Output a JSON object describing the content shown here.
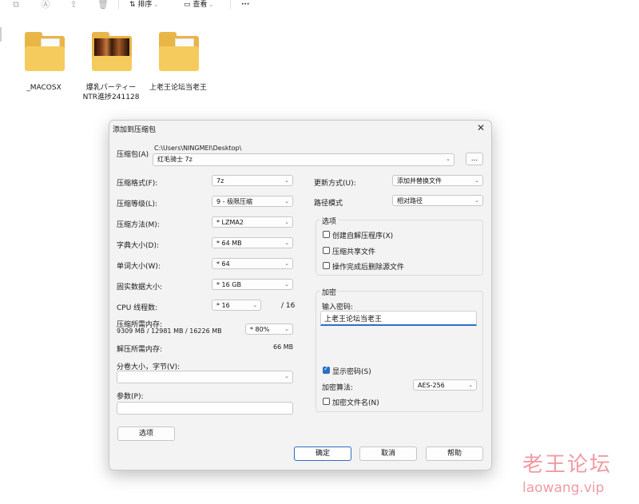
{
  "toolbar": {
    "sort_label": "排序",
    "view_label": "查看",
    "more_label": "···"
  },
  "files": [
    {
      "name": "_MACOSX",
      "thumb": false
    },
    {
      "name": "爆乳パーティー NTR進捗241128",
      "thumb": true
    },
    {
      "name": "上老王论坛当老王",
      "thumb": false
    }
  ],
  "dialog": {
    "title": "添加到压缩包",
    "archive_label": "压缩包(A)",
    "archive_path": "C:\\Users\\NINGMEI\\Desktop\\",
    "archive_name": "红毛骑士 7z",
    "browse_label": "...",
    "format_label": "压缩格式(F):",
    "format_value": "7z",
    "level_label": "压缩等级(L):",
    "level_value": "9 - 极限压缩",
    "method_label": "压缩方法(M):",
    "method_value": "* LZMA2",
    "dict_label": "字典大小(D):",
    "dict_value": "* 64 MB",
    "word_label": "单词大小(W):",
    "word_value": "* 64",
    "solid_label": "固实数据大小:",
    "solid_value": "* 16 GB",
    "cpu_label": "CPU 线程数:",
    "cpu_value": "* 16",
    "cpu_total": "/ 16",
    "mem_label": "压缩所需内存:",
    "mem_detail": "9309 MB / 12981 MB / 16226 MB",
    "mem_value": "* 80%",
    "decomp_label": "解压所需内存:",
    "decomp_value": "66 MB",
    "split_label": "分卷大小，字节(V):",
    "split_value": "",
    "params_label": "参数(P):",
    "params_value": "",
    "options_button": "选项",
    "update_label": "更新方式(U):",
    "update_value": "添加并替换文件",
    "pathmode_label": "路径模式",
    "pathmode_value": "相对路径",
    "options_group": "选项",
    "opt_sfx": "创建自解压程序(X)",
    "opt_shared": "压缩共享文件",
    "opt_delete": "操作完成后删除源文件",
    "encrypt_group": "加密",
    "password_label": "输入密码:",
    "password_value": "上老王论坛当老王",
    "show_password": "显示密码(S)",
    "enc_method_label": "加密算法:",
    "enc_method_value": "AES-256",
    "encrypt_names": "加密文件名(N)",
    "ok_button": "确定",
    "cancel_button": "取消",
    "help_button": "帮助"
  },
  "watermark": {
    "cn": "老王论坛",
    "url": "laowang.vip"
  }
}
